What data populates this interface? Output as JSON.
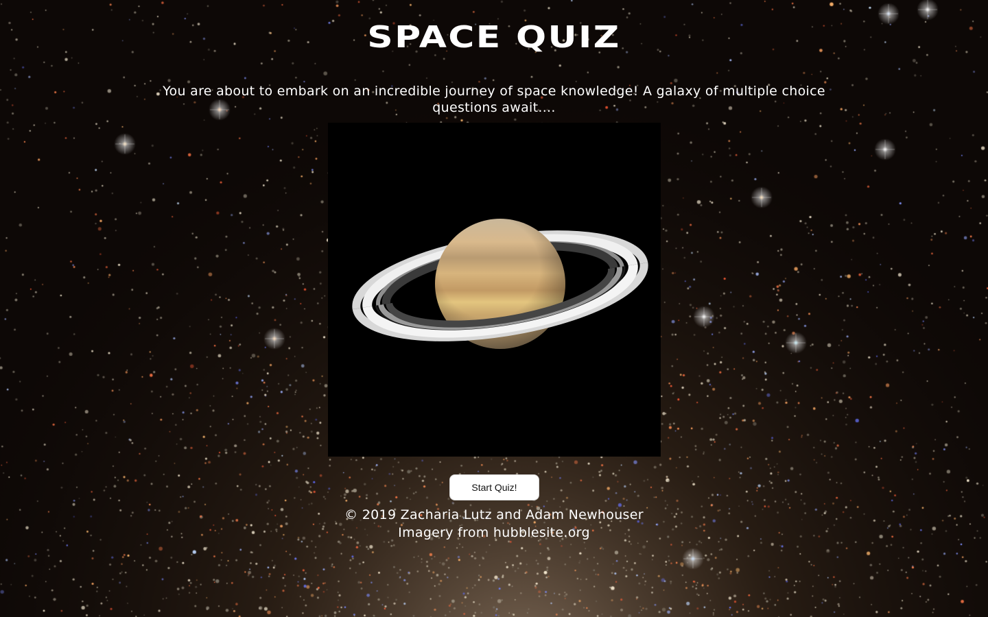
{
  "page": {
    "title": "SPACE QUIZ",
    "intro": "You are about to embark on an incredible journey of space knowledge! A galaxy of multiple choice questions await....",
    "start_button_label": "Start Quiz!",
    "footer": {
      "copyright": "© 2019 Zacharia Lutz and Adam Newhouser",
      "credit": "Imagery from hubblesite.org"
    }
  },
  "images": {
    "background": "star-cluster-photo",
    "hero": "saturn-photo"
  },
  "colors": {
    "text": "#ffffff",
    "button_bg": "#ffffff",
    "button_text": "#111111",
    "hero_bg": "#000000"
  }
}
